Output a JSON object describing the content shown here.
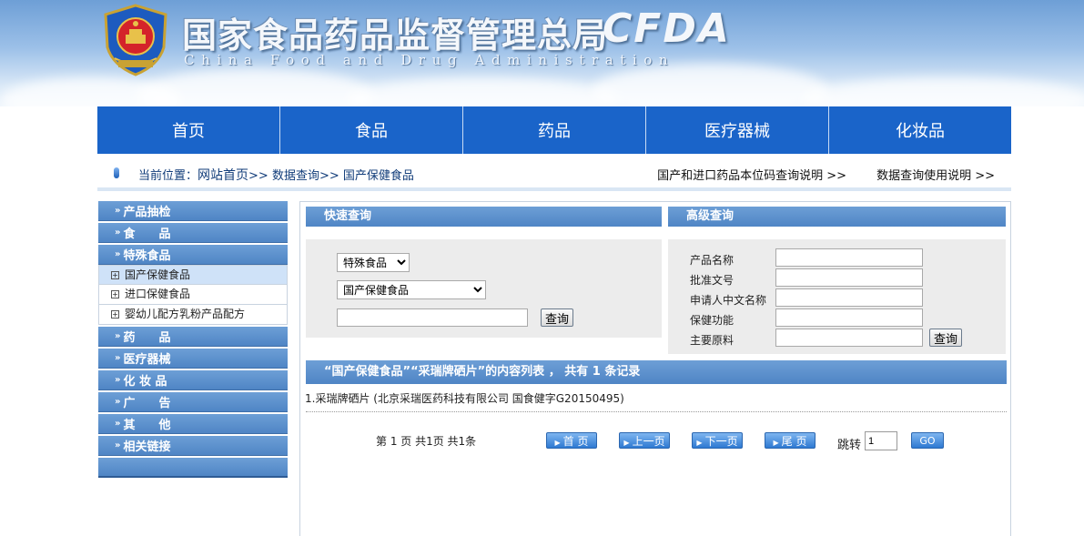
{
  "header": {
    "title": "国家食品药品监督管理总局",
    "subtitle": "China Food and Drug Administration",
    "brand": "CFDA"
  },
  "nav": [
    "首页",
    "食品",
    "药品",
    "医疗器械",
    "化妆品"
  ],
  "breadcrumb": {
    "prefix": "当前位置：",
    "home": "网站首页",
    "sep": ">>",
    "level1": "数据查询",
    "level2": "国产保健食品",
    "right_links": [
      "国产和进口药品本位码查询说明 >>",
      "数据查询使用说明 >>"
    ]
  },
  "sidebar": {
    "cat_product_check": "产品抽检",
    "cat_food": "食　　品",
    "cat_special_food": "特殊食品",
    "sub_items": [
      "国产保健食品",
      "进口保健食品",
      "婴幼儿配方乳粉产品配方"
    ],
    "cat_drug": "药　　品",
    "cat_device": "医疗器械",
    "cat_cosmetics": "化 妆 品",
    "cat_ad": "广　　告",
    "cat_other": "其　　他",
    "cat_links": "相关链接",
    "bullet": "»"
  },
  "quick_search": {
    "title": "快速查询",
    "category_value": "特殊食品",
    "subcategory_value": "国产保健食品",
    "keyword_value": "",
    "button": "查询"
  },
  "advanced_search": {
    "title": "高级查询",
    "fields": [
      "产品名称",
      "批准文号",
      "申请人中文名称",
      "保健功能",
      "主要原料"
    ],
    "button": "查询"
  },
  "results": {
    "header": "“国产保健食品”“采瑞牌硒片”的内容列表 ， 共有 1 条记录",
    "items": [
      "1.采瑞牌硒片 (北京采瑞医药科技有限公司 国食健字G20150495)"
    ]
  },
  "pager": {
    "status": "第 1 页 共1页 共1条",
    "first": "首 页",
    "prev": "上一页",
    "next": "下一页",
    "last": "尾 页",
    "jump_label": "跳转",
    "jump_value": "1",
    "go": "GO"
  },
  "colors": {
    "nav_blue": "#1a64c9",
    "panel_blue": "#5a8fcd",
    "button_blue": "#2e79d2"
  }
}
